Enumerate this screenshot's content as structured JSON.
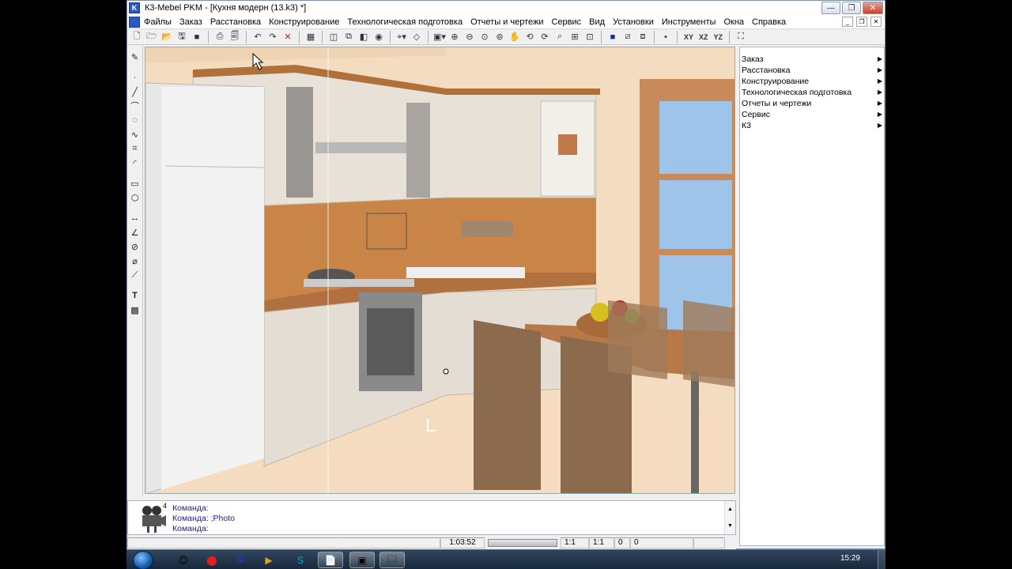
{
  "window": {
    "title": "К3-Mebel PKM - [Кухня модерн (13.k3) *]",
    "app_icon": "k3-icon"
  },
  "menu": {
    "items": [
      "Файлы",
      "Заказ",
      "Расстановка",
      "Конструирование",
      "Технологическая подготовка",
      "Отчеты и чертежи",
      "Сервис",
      "Вид",
      "Установки",
      "Инструменты",
      "Окна",
      "Справка"
    ]
  },
  "toolbar": {
    "view_xy": "XY",
    "view_xz": "XZ",
    "view_yz": "YZ"
  },
  "side_menu": {
    "items": [
      "Заказ",
      "Расстановка",
      "Конструирование",
      "Технологическая подготовка",
      "Отчеты и чертежи",
      "Сервис",
      "К3"
    ]
  },
  "command": {
    "count": "4",
    "lines": [
      "Команда:",
      "Команда: ;Photo",
      "Команда:"
    ]
  },
  "status": {
    "time": "1:03:52",
    "scale1": "1:1",
    "scale2": "1:1",
    "val1": "0",
    "val2": "0"
  },
  "taskbar": {
    "clock": "15:29"
  },
  "colors": {
    "wall": "#f4dcc0",
    "backsplash": "#c98548",
    "cabinet": "#e7e1d8",
    "table": "#b87848",
    "floor": "#f5dcc0",
    "sky": "#9fc4ea"
  }
}
